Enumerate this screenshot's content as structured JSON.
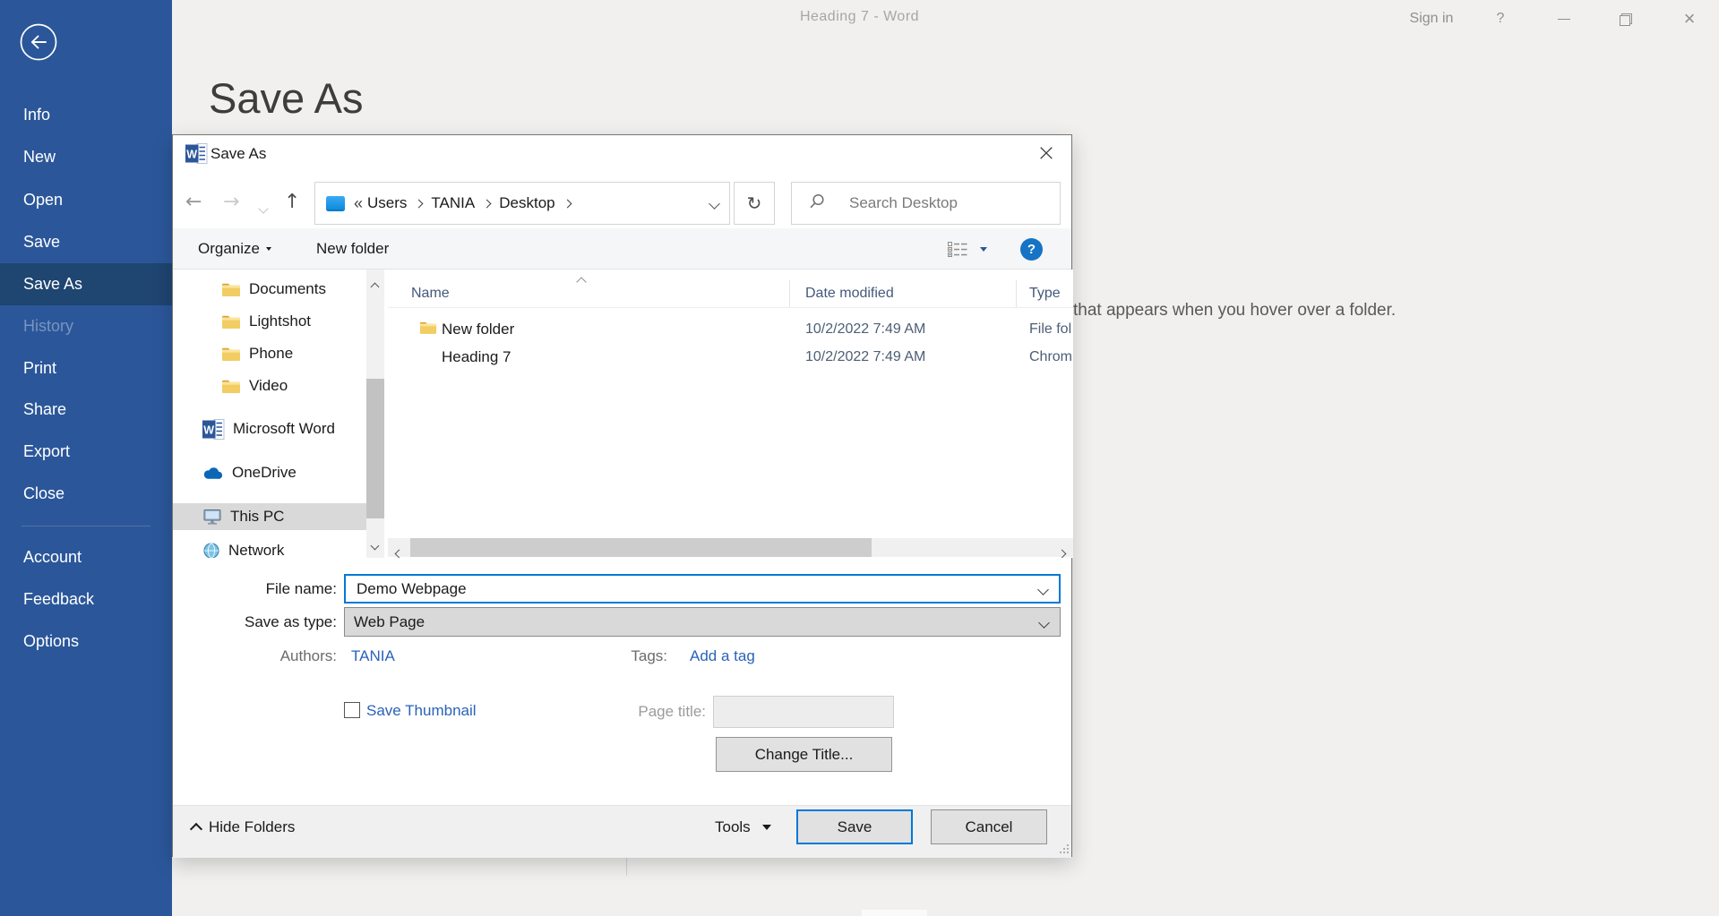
{
  "titlebar": {
    "title": "Heading 7  -  Word",
    "sign_in": "Sign in",
    "help_glyph": "?",
    "close_glyph": "×"
  },
  "icons": {
    "back_arrow": "←",
    "forward_arrow": "→",
    "up_arrow": "↑",
    "refresh": "↻",
    "overflow": "«",
    "help": "?",
    "dialog_close": "×"
  },
  "sidebar": {
    "items": [
      {
        "label": "Info"
      },
      {
        "label": "New"
      },
      {
        "label": "Open"
      },
      {
        "label": "Save"
      },
      {
        "label": "Save As",
        "state": "active"
      },
      {
        "label": "History",
        "state": "disabled"
      },
      {
        "label": "Print"
      },
      {
        "label": "Share"
      },
      {
        "label": "Export"
      },
      {
        "label": "Close"
      }
    ],
    "footer_items": [
      {
        "label": "Account"
      },
      {
        "label": "Feedback"
      },
      {
        "label": "Options"
      }
    ]
  },
  "backstage": {
    "heading": "Save As",
    "background_text": "that appears when you hover over a folder."
  },
  "dialog": {
    "title": "Save As",
    "address": {
      "crumbs": [
        "Users",
        "TANIA",
        "Desktop"
      ]
    },
    "search": {
      "placeholder": "Search Desktop"
    },
    "toolbar": {
      "organize": "Organize",
      "new_folder": "New folder"
    },
    "nav": [
      {
        "label": "Documents"
      },
      {
        "label": "Lightshot"
      },
      {
        "label": "Phone"
      },
      {
        "label": "Video"
      },
      {
        "label": "Microsoft Word"
      },
      {
        "label": "OneDrive"
      },
      {
        "label": "This PC"
      },
      {
        "label": "Network"
      }
    ],
    "list": {
      "columns": [
        "Name",
        "Date modified",
        "Type"
      ],
      "rows": [
        {
          "name": "New folder",
          "icon": "folder-icon",
          "date": "10/2/2022 7:49 AM",
          "type": "File fol"
        },
        {
          "name": "Heading 7",
          "icon": "chrome-icon",
          "date": "10/2/2022 7:49 AM",
          "type": "Chrom"
        }
      ]
    },
    "fields": {
      "file_name_label": "File name:",
      "file_name_value": "Demo Webpage",
      "save_type_label": "Save as type:",
      "save_type_value": "Web Page",
      "authors_label": "Authors:",
      "authors_value": "TANIA",
      "tags_label": "Tags:",
      "add_tag": "Add a tag",
      "save_thumbnail": "Save Thumbnail",
      "page_title_label": "Page title:",
      "change_title": "Change Title..."
    },
    "footer": {
      "hide_folders": "Hide Folders",
      "tools": "Tools",
      "save": "Save",
      "cancel": "Cancel"
    }
  },
  "colors": {
    "sidebar_blue": "#2b579a",
    "sidebar_active": "#1f4571",
    "focus_border": "#0078d7",
    "link_blue": "#2a62b9",
    "selection_gray": "#d9d9d9"
  }
}
